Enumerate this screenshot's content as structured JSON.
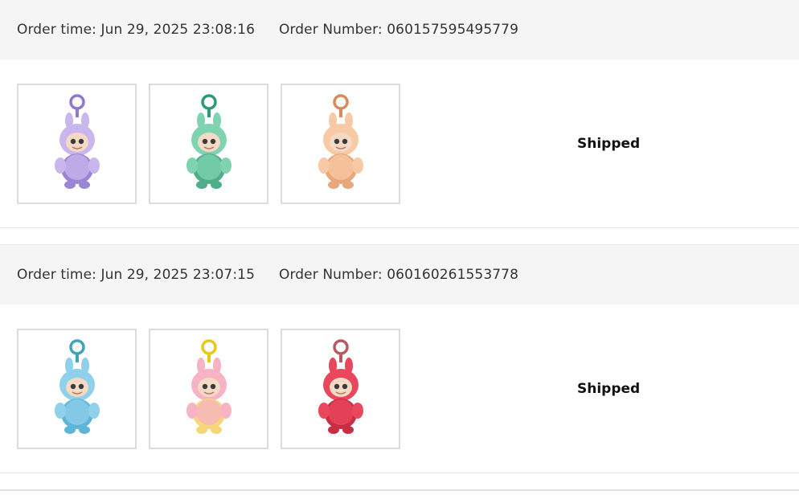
{
  "labels": {
    "order_time_prefix": "Order time:",
    "order_number_prefix": "Order Number:"
  },
  "orders": [
    {
      "time": "Jun 29, 2025 23:08:16",
      "number": "060157595495779",
      "status": "Shipped",
      "products": [
        {
          "name": "lavender-plush-keychain",
          "color": "#c9b6ec",
          "accent": "#9b86d6",
          "ring": "#8f78d2"
        },
        {
          "name": "mint-plush-keychain",
          "color": "#7fd3b0",
          "accent": "#4fae8a",
          "ring": "#2f9a76"
        },
        {
          "name": "peach-plush-keychain",
          "color": "#f7c9a4",
          "accent": "#e9a77c",
          "ring": "#d88a5a"
        }
      ]
    },
    {
      "time": "Jun 29, 2025 23:07:15",
      "number": "060160261553778",
      "status": "Shipped",
      "products": [
        {
          "name": "blue-plush-keychain",
          "color": "#8fd0ea",
          "accent": "#5fb5d8",
          "ring": "#3da5b8"
        },
        {
          "name": "sunset-plush-keychain",
          "color": "#f6b3c4",
          "accent": "#f7d67a",
          "ring": "#e8c820"
        },
        {
          "name": "red-plush-keychain",
          "color": "#e9485c",
          "accent": "#c92e44",
          "ring": "#b85a64"
        }
      ]
    }
  ]
}
